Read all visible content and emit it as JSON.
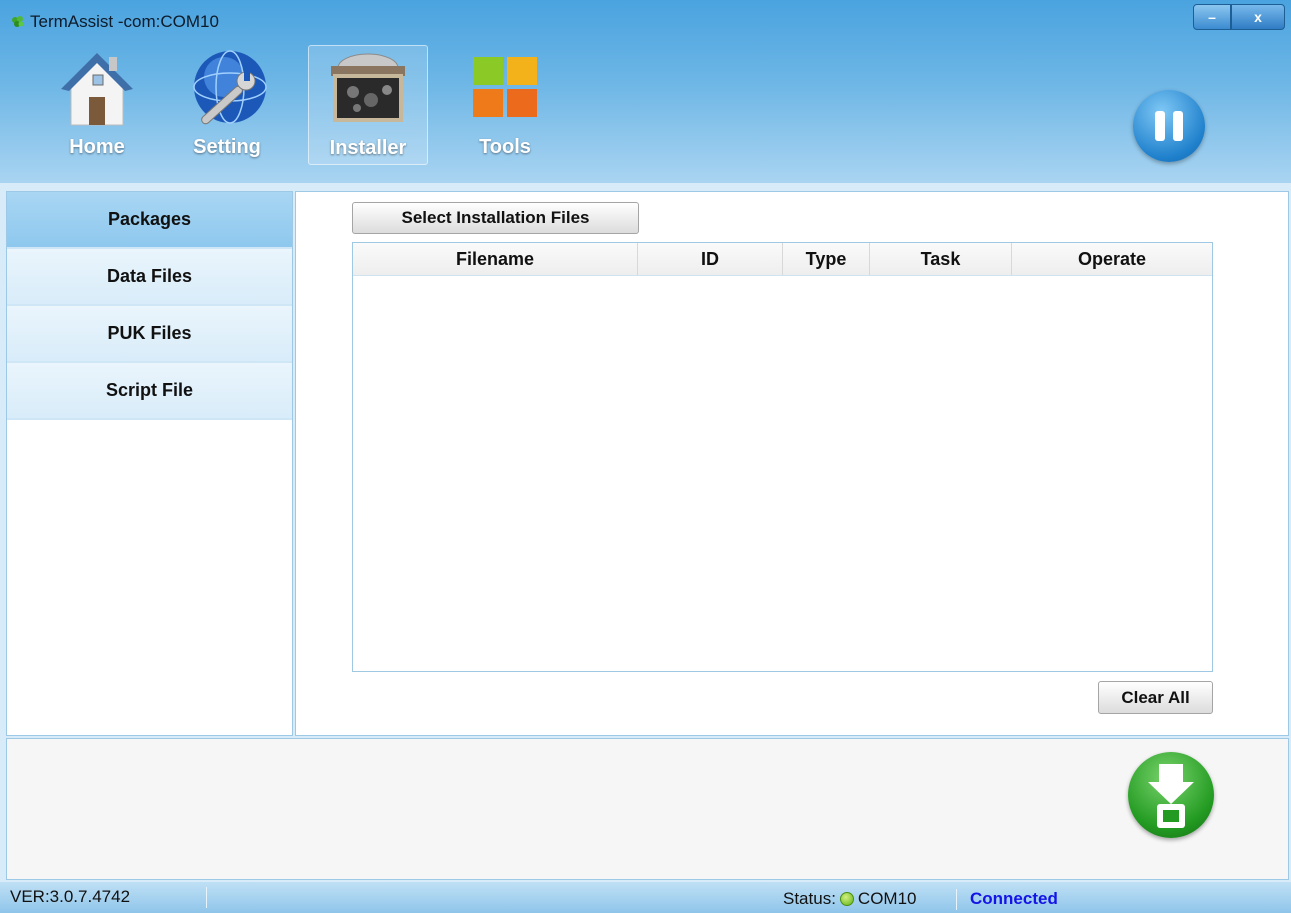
{
  "window": {
    "title": "TermAssist -com:COM10",
    "minimize_label": "–",
    "close_label": "x"
  },
  "nav": {
    "home": "Home",
    "setting": "Setting",
    "installer": "Installer",
    "tools": "Tools"
  },
  "sidebar": {
    "items": [
      {
        "label": "Packages",
        "active": true
      },
      {
        "label": "Data Files",
        "active": false
      },
      {
        "label": "PUK Files",
        "active": false
      },
      {
        "label": "Script File",
        "active": false
      }
    ]
  },
  "main": {
    "select_button": "Select Installation Files",
    "clear_button": "Clear All",
    "table": {
      "columns": [
        "Filename",
        "ID",
        "Type",
        "Task",
        "Operate"
      ],
      "rows": []
    }
  },
  "statusbar": {
    "version": "VER:3.0.7.4742",
    "status_label": "Status:",
    "port": "COM10",
    "connection": "Connected"
  },
  "colors": {
    "accent": "#4aa3df",
    "connected_text": "#1414e6",
    "status_dot": "#60b317",
    "download_button": "#239b22"
  },
  "icons": [
    "app-leaf-icon",
    "home-icon",
    "settings-wrench-globe-icon",
    "installer-box-icon",
    "tools-grid-icon",
    "pause-icon",
    "download-icon",
    "status-dot-icon"
  ]
}
